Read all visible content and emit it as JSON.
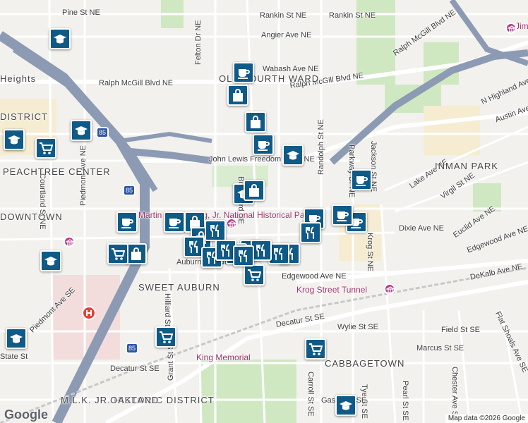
{
  "map": {
    "attribution": "Map data ©2026 Google",
    "logo": "Google",
    "colors": {
      "background": "#f2f1ee",
      "highway": "#8c9bb3",
      "major_road": "#ffffff",
      "park": "#cfe8c2",
      "water": "#aad3df",
      "pin": "#0f5a86",
      "poi_label": "#a0306a",
      "hospital": "#e0433b"
    },
    "street_labels": [
      "Pine St NE",
      "Rankin St NE",
      "Rankin St NE",
      "Angier Ave NE",
      "Ralph McGill Blvd NE",
      "Ralph McGill Blvd NE",
      "Ralph McGill Blvd NE",
      "Wabash Ave NE",
      "Felton Dr NE",
      "John Lewis Freedom Pkwy NE",
      "Lake Ave NE",
      "Virgil St NE",
      "Euclid Ave NE",
      "Edgewood Ave NE",
      "Edgewood Ave NE",
      "Dixie Ave NE",
      "DeKalb Ave NE",
      "Krog St NE",
      "Austin Ave NE",
      "N Highland Ave NE",
      "Decatur St SE",
      "Decatur St SE",
      "Wylie St SE",
      "Field St SE",
      "Marcus St SE",
      "Flat Shoals Ave SE",
      "Chester Ave SE",
      "Pearl St SE",
      "Tye St SE",
      "Gaskill St SE",
      "Courtland St NE",
      "Piedmont Ave NE",
      "Piedmont Ave SE",
      "Grant St SE",
      "Hilliard St SE",
      "Boulevard NE",
      "Carroll St SE",
      "Parkway Dr NE",
      "Randolph St NE",
      "Jackson St NE",
      "Auburn Ave NE",
      "State St"
    ],
    "area_labels": [
      "INMAN PARK",
      "SWEET AUBURN",
      "CABBAGETOWN",
      "OLD FOURTH WARD",
      "PEACHTREE CENTER",
      "DISTRICT",
      "DOWNTOWN",
      "M.L.K. JR. HISTORIC DISTRICT",
      "OAKLAND",
      "Heights"
    ],
    "poi_labels": [
      "Krog Street Tunnel",
      "King Memorial",
      "Martin Luther King, Jr. National Historical Park",
      "Jimmy Carter Presidential Library"
    ],
    "interstate_shield": "85",
    "pins": [
      {
        "type": "school-icon"
      },
      {
        "type": "school-icon"
      },
      {
        "type": "school-icon"
      },
      {
        "type": "school-icon"
      },
      {
        "type": "school-icon"
      },
      {
        "type": "school-icon"
      },
      {
        "type": "school-icon"
      },
      {
        "type": "school-icon"
      },
      {
        "type": "cafe-icon"
      },
      {
        "type": "cafe-icon"
      },
      {
        "type": "cafe-icon"
      },
      {
        "type": "cafe-icon"
      },
      {
        "type": "cafe-icon"
      },
      {
        "type": "cafe-icon"
      },
      {
        "type": "cafe-icon"
      },
      {
        "type": "cafe-icon"
      },
      {
        "type": "shopping-bag-icon"
      },
      {
        "type": "shopping-bag-icon"
      },
      {
        "type": "shopping-bag-icon"
      },
      {
        "type": "shopping-bag-icon"
      },
      {
        "type": "shopping-bag-icon"
      },
      {
        "type": "shopping-bag-icon"
      },
      {
        "type": "grocery-cart-icon"
      },
      {
        "type": "grocery-cart-icon"
      },
      {
        "type": "grocery-cart-icon"
      },
      {
        "type": "grocery-cart-icon"
      },
      {
        "type": "grocery-cart-icon"
      },
      {
        "type": "restaurant-icon"
      },
      {
        "type": "restaurant-icon"
      },
      {
        "type": "restaurant-icon"
      },
      {
        "type": "restaurant-icon"
      },
      {
        "type": "restaurant-icon"
      },
      {
        "type": "restaurant-icon"
      },
      {
        "type": "restaurant-icon"
      },
      {
        "type": "restaurant-icon"
      },
      {
        "type": "restaurant-icon"
      },
      {
        "type": "restaurant-icon"
      },
      {
        "type": "restaurant-icon"
      }
    ]
  }
}
